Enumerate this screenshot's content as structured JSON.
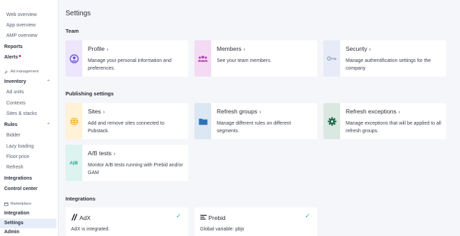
{
  "sidebar": {
    "web_overview": "Web overview",
    "app_overview": "App overview",
    "amp_overview": "AMP overview",
    "reports": "Reports",
    "alerts": "Alerts",
    "ad_management": "Ad management",
    "inventory": "Inventory",
    "ad_units": "Ad units",
    "contexts": "Contexts",
    "sites_stacks": "Sites & stacks",
    "rules": "Rules",
    "bidder": "Bidder",
    "lazy_loading": "Lazy loading",
    "floor_price": "Floor price",
    "refresh": "Refresh",
    "integrations": "Integrations",
    "control_center": "Control center",
    "marketplace": "Marketplace",
    "integration": "Integration",
    "settings": "Settings",
    "admin": "Admin"
  },
  "page": {
    "title": "Settings"
  },
  "sections": {
    "team": "Team",
    "publishing": "Publishing settings",
    "integrations": "Integrations"
  },
  "cards": {
    "profile": {
      "title": "Profile",
      "desc": "Manage your personal information and preferences.",
      "color": "#ece5fb",
      "icon_color": "#6b4fd8"
    },
    "members": {
      "title": "Members",
      "desc": "See your team members.",
      "color": "#f3dbf3",
      "icon_color": "#b33bb3"
    },
    "security": {
      "title": "Security",
      "desc": "Manage authentification settings for the company",
      "color": "#e7ebf7",
      "icon_color": "#9aa8cc"
    },
    "sites": {
      "title": "Sites",
      "desc": "Add and remove sites connected to Pubstack.",
      "color": "#fff2d6",
      "icon_color": "#f3b731"
    },
    "refresh_groups": {
      "title": "Refresh groups",
      "desc": "Manage different rules on different segments.",
      "color": "#dbe7f3",
      "icon_color": "#2f72b8"
    },
    "refresh_exceptions": {
      "title": "Refresh exceptions",
      "desc": "Manage exceptions that will be applied to all refresh groups.",
      "color": "#dbe8e2",
      "icon_color": "#1f6a4d"
    },
    "ab_tests": {
      "title": "A/B tests",
      "desc": "Monitor A/B tests running with Prebid and/or GAM",
      "color": "#dcf3ef",
      "icon_color": "#1e9c88",
      "icon_text": "A|B"
    }
  },
  "integrations": {
    "adx": {
      "title": "AdX",
      "desc": "AdX is integrated."
    },
    "prebid": {
      "title": "Prebid",
      "desc": "Global variable: pbjs"
    }
  },
  "colors": {
    "alert_dot": "#e0245e",
    "check": "#2bb673",
    "active_bg": "#e8eef9"
  }
}
